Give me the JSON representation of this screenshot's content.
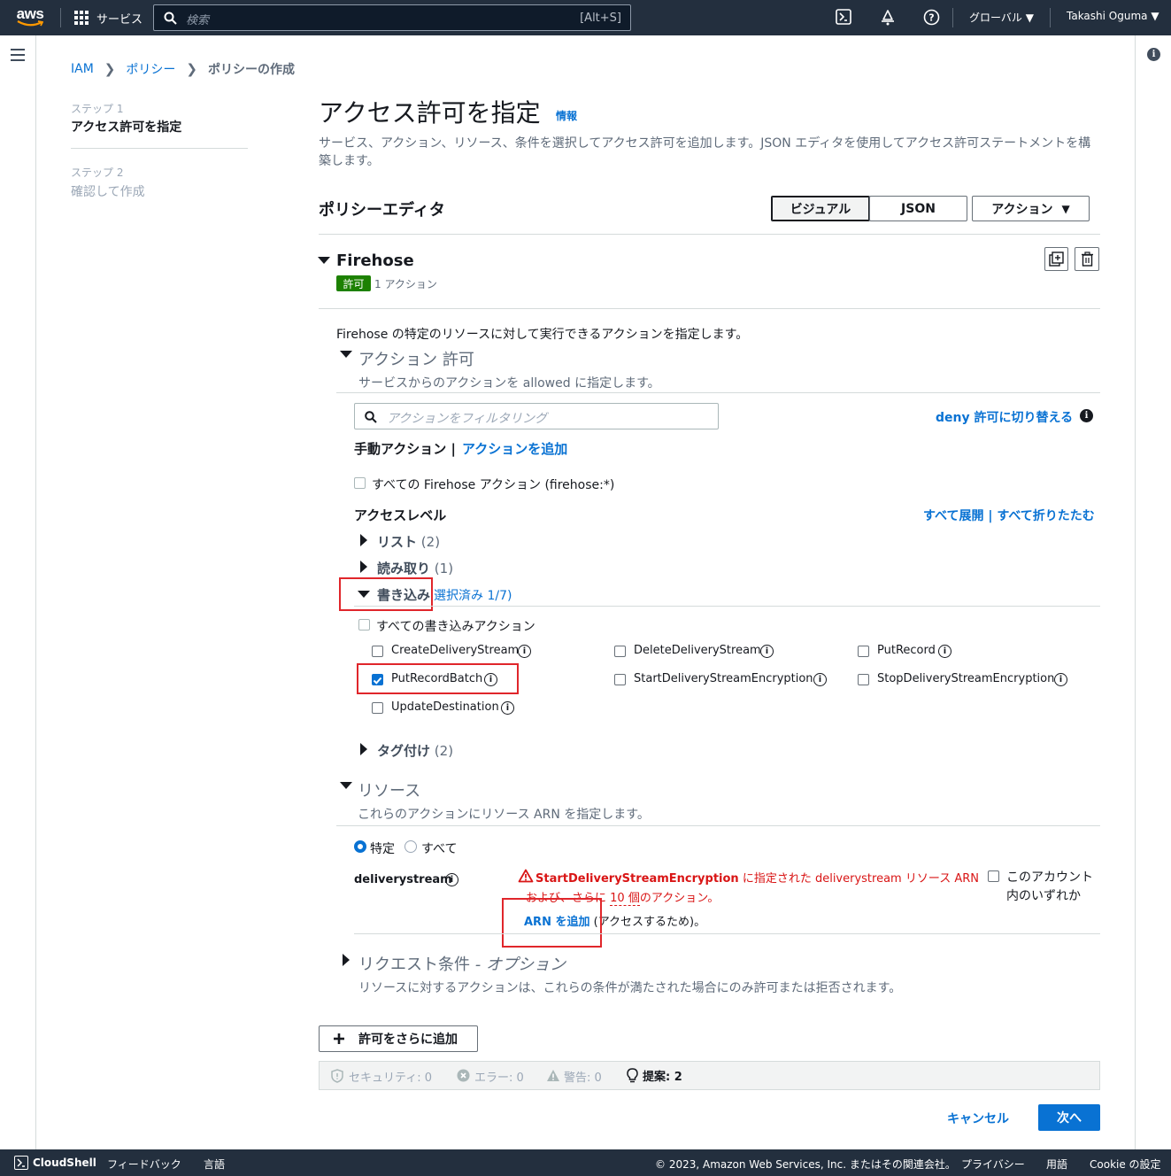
{
  "topnav": {
    "logo": "aws",
    "services": "サービス",
    "search_placeholder": "検索",
    "search_shortcut": "[Alt+S]",
    "region": "グローバル",
    "user": "Takashi Oguma"
  },
  "breadcrumb": {
    "items": [
      "IAM",
      "ポリシー",
      "ポリシーの作成"
    ]
  },
  "steps": [
    {
      "step": "ステップ 1",
      "label": "アクセス許可を指定"
    },
    {
      "step": "ステップ 2",
      "label": "確認して作成"
    }
  ],
  "page": {
    "title": "アクセス許可を指定",
    "info": "情報",
    "description": "サービス、アクション、リソース、条件を選択してアクセス許可を追加します。JSON エディタを使用してアクセス許可ステートメントを構築します。"
  },
  "editor": {
    "title": "ポリシーエディタ",
    "tabs": [
      "ビジュアル",
      "JSON"
    ],
    "actions_label": "アクション"
  },
  "service": {
    "name": "Firehose",
    "badge": "許可",
    "action_count": "1 アクション",
    "description": "Firehose の特定のリソースに対して実行できるアクションを指定します。"
  },
  "actions": {
    "title": "アクション 許可",
    "subtitle": "サービスからのアクションを allowed に指定します。",
    "filter_placeholder": "アクションをフィルタリング",
    "deny_switch": "deny 許可に切り替える",
    "manual_label": "手動アクション |",
    "add_action": "アクションを追加",
    "all_actions": "すべての Firehose アクション (firehose:*)",
    "access_level": "アクセスレベル",
    "expand_all": "すべて展開",
    "collapse_all": "すべて折りたたむ",
    "levels": [
      {
        "name": "リスト",
        "count": "(2)"
      },
      {
        "name": "読み取り",
        "count": "(1)"
      },
      {
        "name": "書き込み",
        "selected": "選択済み 1/7)"
      },
      {
        "name": "タグ付け",
        "count": "(2)"
      }
    ],
    "write_all": "すべての書き込みアクション",
    "write_actions": [
      {
        "name": "CreateDeliveryStream",
        "checked": false
      },
      {
        "name": "DeleteDeliveryStream",
        "checked": false
      },
      {
        "name": "PutRecord",
        "checked": false
      },
      {
        "name": "PutRecordBatch",
        "checked": true
      },
      {
        "name": "StartDeliveryStreamEncryption",
        "checked": false
      },
      {
        "name": "StopDeliveryStreamEncryption",
        "checked": false
      },
      {
        "name": "UpdateDestination",
        "checked": false
      }
    ]
  },
  "resources": {
    "title": "リソース",
    "subtitle": "これらのアクションにリソース ARN を指定します。",
    "specific": "特定",
    "all": "すべて",
    "type": "deliverystream",
    "warn_action": "StartDeliveryStreamEncryption",
    "warn_rest": " に指定された deliverystream リソース ARN",
    "warn_line2_a": "および、さらに",
    "warn_count": "10 個",
    "warn_line2_b": "のアクション。",
    "add_arn": "ARN を追加",
    "add_arn_suffix": "(アクセスするため)。",
    "any_account_1": "このアカウント",
    "any_account_2": "内のいずれか"
  },
  "conditions": {
    "title": "リクエスト条件",
    "optional": " - オプション",
    "subtitle": "リソースに対するアクションは、これらの条件が満たされた場合にのみ許可または拒否されます。"
  },
  "add_more": "許可をさらに追加",
  "validation": {
    "security": "セキュリティ: 0",
    "errors": "エラー: 0",
    "warnings": "警告: 0",
    "suggestions": "提案: 2"
  },
  "buttons": {
    "cancel": "キャンセル",
    "next": "次へ"
  },
  "footer": {
    "cloudshell": "CloudShell",
    "feedback": "フィードバック",
    "language": "言語",
    "copyright": "© 2023, Amazon Web Services, Inc. またはその関連会社。",
    "privacy": "プライバシー",
    "terms": "用語",
    "cookie": "Cookie の設定"
  }
}
